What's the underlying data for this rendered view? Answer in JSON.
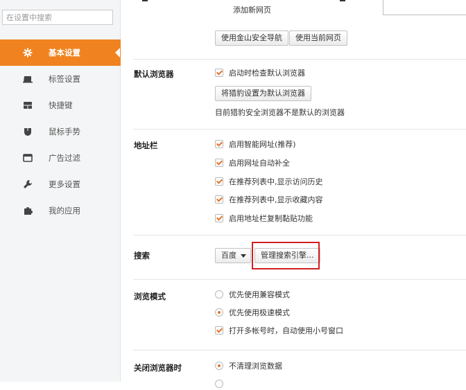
{
  "sidebar": {
    "search_placeholder": "在设置中搜索",
    "items": [
      {
        "label": "基本设置",
        "icon": "gear-icon"
      },
      {
        "label": "标签设置",
        "icon": "tab-icon"
      },
      {
        "label": "快捷键",
        "icon": "keyboard-icon"
      },
      {
        "label": "鼠标手势",
        "icon": "mouse-icon"
      },
      {
        "label": "广告过滤",
        "icon": "window-icon"
      },
      {
        "label": "更多设置",
        "icon": "wrench-icon"
      },
      {
        "label": "我的应用",
        "icon": "puzzle-icon"
      }
    ]
  },
  "homepage": {
    "new_page_label": "添加新网页",
    "btn_use_nav": "使用金山安全导航",
    "btn_use_current": "使用当前网页"
  },
  "default_browser": {
    "title": "默认浏览器",
    "check_on_start": "启动时检查默认浏览器",
    "set_default_btn": "将猎豹设置为默认浏览器",
    "status": "目前猎豹安全浏览器不是默认的浏览器"
  },
  "address_bar": {
    "title": "地址栏",
    "options": [
      "启用智能网址(推荐)",
      "启用网址自动补全",
      "在推荐列表中,显示访问历史",
      "在推荐列表中,显示收藏内容",
      "启用地址栏复制黏贴功能"
    ]
  },
  "search": {
    "title": "搜索",
    "engine": "百度",
    "manage_btn": "管理搜索引擎..."
  },
  "browse_mode": {
    "title": "浏览模式",
    "opt_compat": "优先使用兼容模式",
    "opt_fast": "优先使用极速模式",
    "opt_multi": "打开多帐号时，自动使用小号窗口"
  },
  "on_close": {
    "title": "关闭浏览器时",
    "opt_keep": "不清理浏览数据"
  },
  "colors": {
    "accent": "#f0831f",
    "highlight": "#d21f1f"
  }
}
